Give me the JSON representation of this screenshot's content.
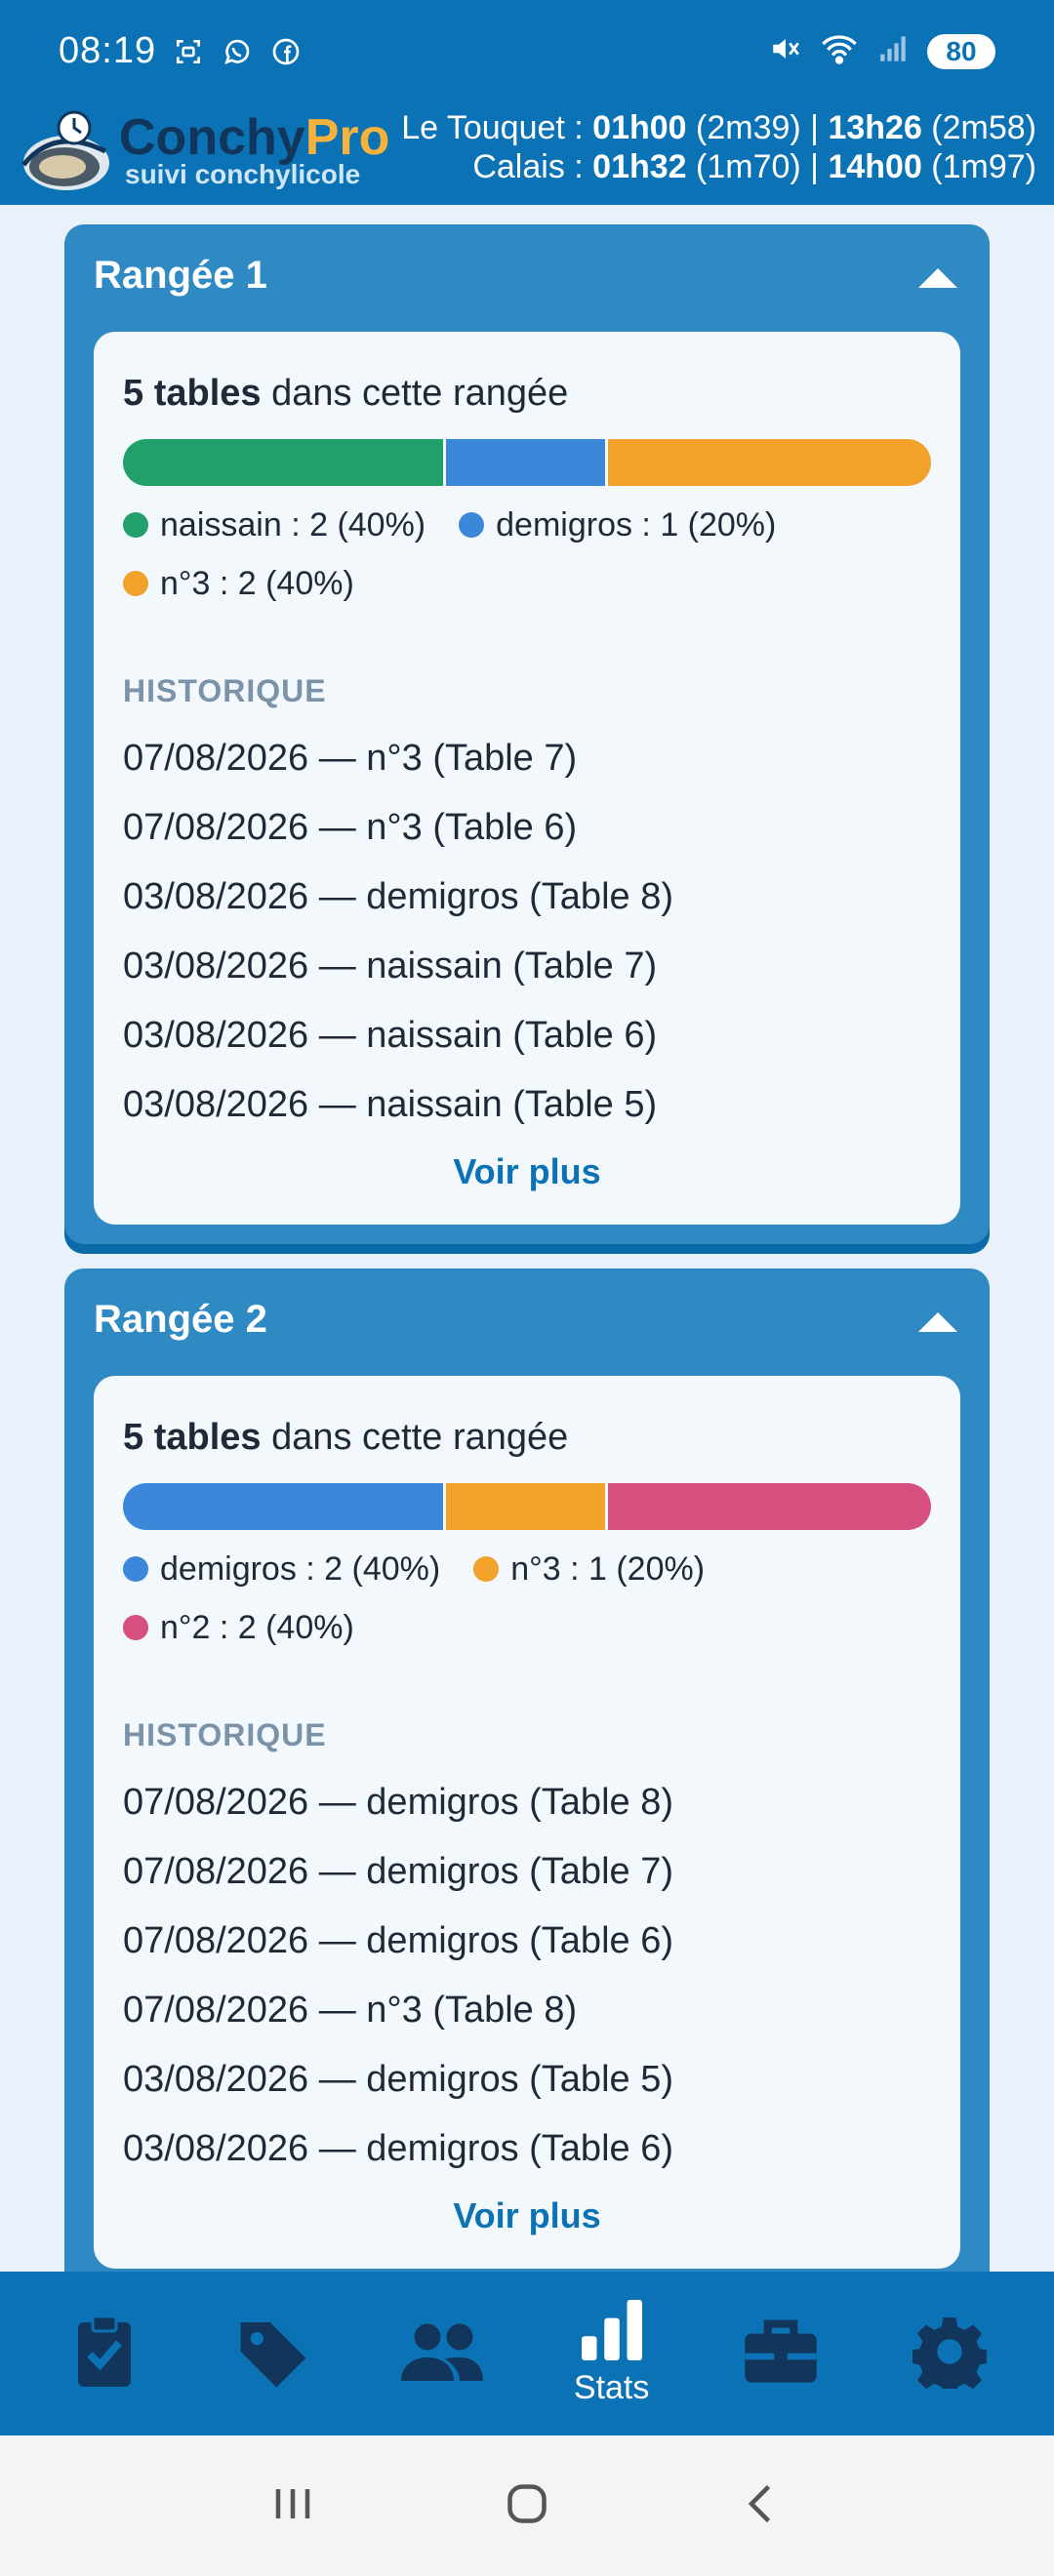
{
  "status_bar": {
    "time": "08:19",
    "battery": "80",
    "icons": [
      "screenshot-icon",
      "whatsapp-icon",
      "facebook-icon",
      "mute-icon",
      "wifi-icon",
      "signal-icon"
    ]
  },
  "app_header": {
    "brand_part1": "Conchy",
    "brand_part2": "Pro",
    "subtitle": "suivi conchylicole",
    "tide1_place": "Le Touquet : ",
    "tide1_t1": "01h00",
    "tide1_h1": " (2m39) | ",
    "tide1_t2": "13h26",
    "tide1_h2": " (2m58)",
    "tide2_place": "Calais : ",
    "tide2_t1": "01h32",
    "tide2_h1": " (1m70) | ",
    "tide2_t2": "14h00",
    "tide2_h2": " (1m97)"
  },
  "colors": {
    "naissain": "#22a06b",
    "demigros": "#3b88db",
    "n3": "#f2a12b",
    "n2": "#d64f7e",
    "primary": "#0b72b5"
  },
  "rows": [
    {
      "title": "Rangée 1",
      "count_bold": "5 tables",
      "count_rest": " dans cette rangée",
      "segments": [
        {
          "key": "naissain",
          "fraction": 0.4
        },
        {
          "key": "demigros",
          "fraction": 0.2
        },
        {
          "key": "n3",
          "fraction": 0.4
        }
      ],
      "legend": [
        {
          "label": "naissain : 2 (40%)",
          "key": "naissain"
        },
        {
          "label": "demigros : 1 (20%)",
          "key": "demigros"
        },
        {
          "label": "n°3 : 2 (40%)",
          "key": "n3"
        }
      ],
      "history_label": "HISTORIQUE",
      "history": [
        "07/08/2026 — n°3 (Table 7)",
        "07/08/2026 — n°3 (Table 6)",
        "03/08/2026 — demigros (Table 8)",
        "03/08/2026 — naissain (Table 7)",
        "03/08/2026 — naissain (Table 6)",
        "03/08/2026 — naissain (Table 5)"
      ],
      "more": "Voir plus"
    },
    {
      "title": "Rangée 2",
      "count_bold": "5 tables",
      "count_rest": " dans cette rangée",
      "segments": [
        {
          "key": "demigros",
          "fraction": 0.4
        },
        {
          "key": "n3",
          "fraction": 0.2
        },
        {
          "key": "n2",
          "fraction": 0.4
        }
      ],
      "legend": [
        {
          "label": "demigros : 2 (40%)",
          "key": "demigros"
        },
        {
          "label": "n°3 : 1 (20%)",
          "key": "n3"
        },
        {
          "label": "n°2 : 2 (40%)",
          "key": "n2"
        }
      ],
      "history_label": "HISTORIQUE",
      "history": [
        "07/08/2026 — demigros (Table 8)",
        "07/08/2026 — demigros (Table 7)",
        "07/08/2026 — demigros (Table 6)",
        "07/08/2026 — n°3 (Table 8)",
        "03/08/2026 — demigros (Table 5)",
        "03/08/2026 — demigros (Table 6)"
      ],
      "more": "Voir plus"
    }
  ],
  "bottom_nav": [
    {
      "icon": "clipboard-check-icon"
    },
    {
      "icon": "tag-icon"
    },
    {
      "icon": "people-icon"
    },
    {
      "icon": "bar-chart-icon",
      "label": "Stats",
      "active": true
    },
    {
      "icon": "briefcase-icon"
    },
    {
      "icon": "gear-icon"
    }
  ]
}
